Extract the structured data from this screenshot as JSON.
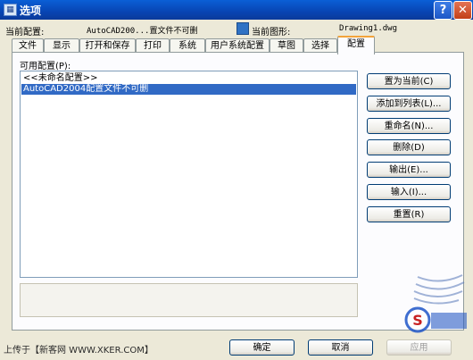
{
  "window": {
    "title": "选项",
    "help_glyph": "?",
    "close_glyph": "✕"
  },
  "header": {
    "current_profile_label": "当前配置:",
    "current_profile_value": "AutoCAD200...置文件不可删",
    "current_drawing_label": "当前图形:",
    "current_drawing_value": "Drawing1.dwg"
  },
  "tabs": [
    {
      "label": "文件"
    },
    {
      "label": "显示"
    },
    {
      "label": "打开和保存"
    },
    {
      "label": "打印"
    },
    {
      "label": "系统"
    },
    {
      "label": "用户系统配置"
    },
    {
      "label": "草图"
    },
    {
      "label": "选择"
    },
    {
      "label": "配置",
      "active": true
    }
  ],
  "profiles": {
    "label": "可用配置(P):",
    "items": [
      {
        "label": "<<未命名配置>>",
        "selected": false
      },
      {
        "label": "AutoCAD2004配置文件不可删",
        "selected": true
      }
    ]
  },
  "buttons": {
    "set_current": "置为当前(C)",
    "add_to_list": "添加到列表(L)...",
    "rename": "重命名(N)...",
    "delete": "删除(D)",
    "export": "输出(E)...",
    "import": "输入(I)...",
    "reset": "重置(R)"
  },
  "footer": {
    "credit": "上传于【新客网 WWW.XKER.COM】",
    "ok": "确定",
    "cancel": "取消",
    "apply": "应用"
  }
}
